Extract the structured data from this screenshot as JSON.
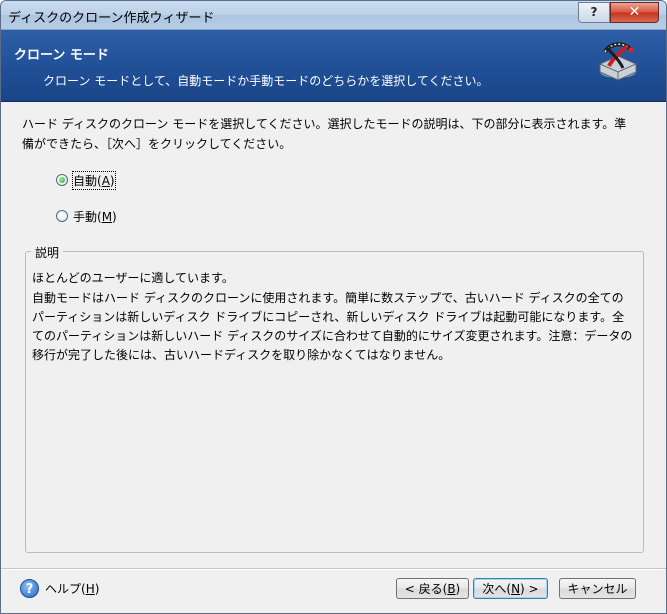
{
  "window": {
    "title": "ディスクのクローン作成ウィザード",
    "help_button": "?",
    "close_button": "✕"
  },
  "header": {
    "title": "クローン モード",
    "description": "クローン モードとして、自動モードか手動モードのどちらかを選択してください。"
  },
  "instructions": {
    "line1": "ハード ディスクのクローン モードを選択してください。選択したモードの説明は、下の部分に表示されます。準",
    "line2": "備ができたら、［次へ］をクリックしてください。"
  },
  "options": {
    "auto": {
      "label": "自動(",
      "key": "A",
      "close": ")",
      "checked": true
    },
    "manual": {
      "label": "手動(",
      "key": "M",
      "close": ")",
      "checked": false
    }
  },
  "description_group": {
    "legend": "説明",
    "lines": [
      "ほとんどのユーザーに適しています。",
      "自動モードはハード ディスクのクローンに使用されます。簡単に数ステップで、古いハード ディスクの全ての",
      "パーティションは新しいディスク ドライブにコピーされ、新しいディスク ドライブは起動可能になります。全",
      "てのパーティションは新しいハード ディスクのサイズに合わせて自動的にサイズ変更されます。注意：データの",
      "移行が完了した後には、古いハードディスクを取り除かなくてはなりません。"
    ]
  },
  "footer": {
    "help": {
      "label": "ヘルプ(",
      "key": "H",
      "close": ")"
    },
    "back": {
      "label": "< 戻る(",
      "key": "B",
      "close": ")"
    },
    "next": {
      "label": "次へ(",
      "key": "N",
      "close": ") >"
    },
    "cancel": {
      "label": "キャンセル"
    }
  },
  "icons": {
    "header": "disk-clone-icon",
    "help": "help-icon"
  },
  "colors": {
    "header_bg": "#1f4e95",
    "title_bar": "#bcd1e8",
    "close_button": "#c5331e",
    "radio_checked": "#2fa81f",
    "help_icon": "#2165c4"
  }
}
